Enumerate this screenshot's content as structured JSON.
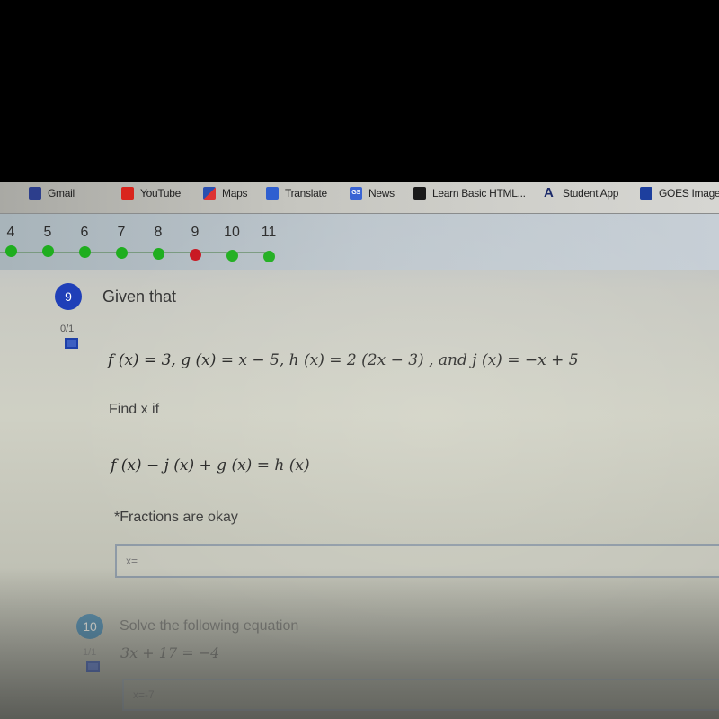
{
  "bookmarks": [
    {
      "label": "Gmail",
      "icon": "gmail-icon"
    },
    {
      "label": "YouTube",
      "icon": "youtube-icon"
    },
    {
      "label": "Maps",
      "icon": "maps-icon"
    },
    {
      "label": "Translate",
      "icon": "translate-icon"
    },
    {
      "label": "News",
      "icon": "news-icon",
      "icon_text": "GS"
    },
    {
      "label": "Learn Basic HTML...",
      "icon": "learn-icon"
    },
    {
      "label": "Student App",
      "icon": "student-app-icon",
      "icon_text": "A"
    },
    {
      "label": "GOES Image",
      "icon": "goes-icon"
    }
  ],
  "question_nav": [
    {
      "number": "4",
      "status": "correct"
    },
    {
      "number": "5",
      "status": "correct"
    },
    {
      "number": "6",
      "status": "correct"
    },
    {
      "number": "7",
      "status": "correct"
    },
    {
      "number": "8",
      "status": "correct"
    },
    {
      "number": "9",
      "status": "incorrect"
    },
    {
      "number": "10",
      "status": "correct"
    },
    {
      "number": "11",
      "status": "correct"
    }
  ],
  "colors": {
    "correct": "#1fae1f",
    "incorrect": "#c81620",
    "badge_active": "#1f3fb8",
    "badge_next": "#1a6fa8"
  },
  "questions": [
    {
      "number": "9",
      "score": "0/1",
      "title": "Given that",
      "given": "f (x) = 3,  g (x) = x − 5,  h (x) = 2 (2x − 3) ,  and j (x) = −x + 5",
      "prompt": "Find x if",
      "equation": "f (x) − j (x) + g (x) = h (x)",
      "note": "*Fractions are okay",
      "answer_value": "",
      "answer_placeholder": "x="
    },
    {
      "number": "10",
      "score": "1/1",
      "title": "Solve the following equation",
      "equation": "3x + 17 = −4",
      "answer_value": "x=-7"
    }
  ]
}
